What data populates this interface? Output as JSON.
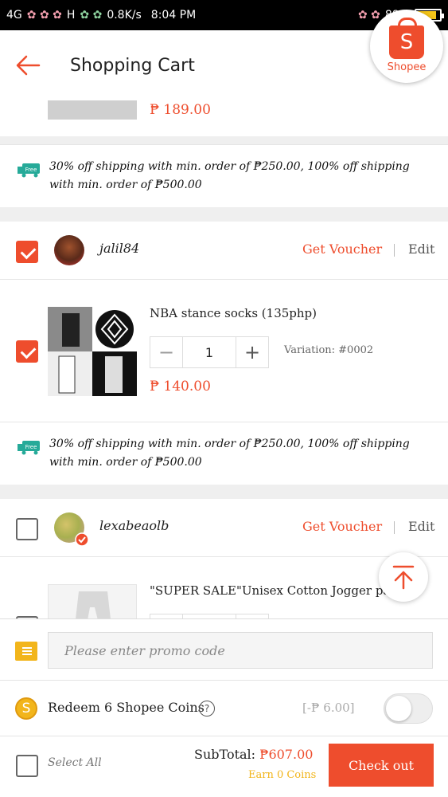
{
  "status_bar": {
    "network_left": "4G",
    "network_mid": "H",
    "speed": "0.8K/s",
    "time": "8:04 PM",
    "battery": "88%",
    "battery_level": 0.88
  },
  "header": {
    "title": "Shopping Cart",
    "logo_letter": "S",
    "logo_text": "Shopee"
  },
  "colors": {
    "accent": "#ee4d2d",
    "coin": "#f2b51b",
    "free_ship": "#26aa99"
  },
  "cart": {
    "top_item_price": "₱ 189.00",
    "shipping_promo_icon": "Free",
    "shipping_promo": "30% off shipping with min. order of ₱250.00, 100% off shipping with min. order of ₱500.00",
    "shops": [
      {
        "name": "jalil84",
        "voucher_label": "Get Voucher",
        "edit_label": "Edit",
        "checked": true,
        "item": {
          "name": "NBA stance socks (135php)",
          "quantity": "1",
          "minus": "−",
          "plus": "+",
          "variation": "Variation: #0002",
          "price": "₱ 140.00",
          "checked": true
        },
        "shipping_promo": "30% off shipping with min. order of ₱250.00, 100% off shipping with min. order of ₱500.00"
      },
      {
        "name": "lexabeaolb",
        "voucher_label": "Get Voucher",
        "edit_label": "Edit",
        "checked": false,
        "item": {
          "name": "\"SUPER SALE\"Unisex Cotton Jogger pants"
        }
      }
    ]
  },
  "bottom_bar": {
    "promo_placeholder": "Please enter promo code",
    "coins_label": "Redeem 6 Shopee Coins",
    "coins_help": "?",
    "coins_value": "[-₱ 6.00]",
    "coins_icon": "S",
    "select_all": "Select All",
    "subtotal_label": "SubTotal:",
    "subtotal_amount": "₱607.00",
    "earn_coins": "Earn 0 Coins",
    "checkout_label": "Check out"
  }
}
